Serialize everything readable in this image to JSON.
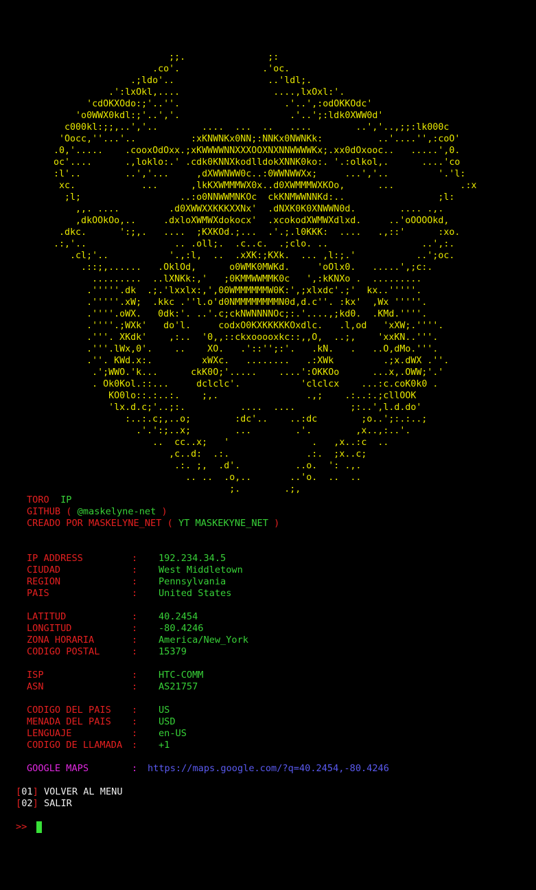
{
  "ascii_art": "                           ;;.               ;:\n                        .co'.               .'oc.\n                    .;ldo'..                 ..'ldl;.\n                .':lxOkl,....                 ....,lxOxl:'.\n            'cdOKXOdo:;'..''.                   .'..',:odOKKOdc'\n          'o0WWX0kdl:;'..','.                    .'..';:ldk0XWW0d'\n        c000kl:;;,..','..        ....  ...  ..   ....        ..','..,;;:lk000c\n       'Oocc,''...'..          :xKNWNKx0NN;:NNKx0NWNKk:          ..'....'',:coO'\n      .0,'.....    .cooxOdOxx.;xKWWWWNNXXXOOXNXNNWWWWKx;.xx0dOxooc..   .....',0.\n      oc'....      .,loklo:.' .cdk0KNNXkodlldokXNNK0ko:. '.:olkol,.      ....'co\n      :l'..        ..','...     ,dXWWNWW0c..:0WWNWWXx;     ...','..         '.'l:\n       xc.            ...      ,lkKXWMMMWX0x..d0XWMMMWXKOo,      ...            .:x\n        ;l;                  ..:o0NNWWMNKOc  ckKNMWWNNKd:..                 ;l:\n          ,,. ....         .d0XWWXXKKKXXNx'  .dNXK0K0XNWWN0d.        .... .,.\n          ,dkOOkOo,..     .dxloXWMWXdokocx'  .xcokodXWMWXdlxd.     ..'oOOOOkd,\n       .dkc.      ':;,.   ....  ;KXKOd.;...  .'.;.l0KKK:  ....   .,::'      :xo.\n      .:,'..                .. .oll;.  .c..c.  .;clo. ..                 ..',:.\n         .cl;'..           '.,:l,  ..  .xXK:;KXk.  ... ,l:;.'           ..';oc.\n           .::;,......   .OklOd,      o0WMK0MWKd.     'oOlx0.   .....',;c:.\n             .........  ..lXNKk:,'   ;0KMMWWMMK0c   ',:kKNXo .  .........\n            .'''''.dk  .;.'lxxlx:,',00WMMMMMMW0K:',;xlxdc'.;'  kx..'''''.\n            .'''''.xW;  .kkc .''l.o'd0NMMMMMMMMN0d,d.c''. :kx'  ,Wx '''''.\n            .''''.oWX.   0dk:'. ..'.c;ckNWNNNNOc;:.'....,;kd0.  .KMd.''''.\n            .''''.;WXk'   do'l.     codxO0KXKKKKKOxdlc.   .l,od   'xXW;.''''.\n            .'''. XKdk'    ,:..  '0,,::ckxooooxkc::,,O,  ..;,    'xxKN..'''.\n            .'''.lWx,0'.    ..    XO.   .'::'';:'.   .kN.   .   ..O,dMo.'''.\n            .''. KWd.x:.         xWXc.   ........   .:XWk         .;x.dWX .''.\n             .';WWO.'k...      ckK0O;'.....    ....':OKKOo      ...x,.OWW;'.'\n             . Ok0Kol.::...     dclclc'.           'clclcx    ...:c.coK0k0 .\n                KO0lo::.:..:.    ;,.                .,;    .:..:.;cllOOK\n                'lx.d.c;'..;:.          ....  ....          ;:..',l.d.do'\n                   :..:.c;,..o;        :dc'..    ..:dc        ;o..';:.:..;\n                     .'.':;..x;        ...        .'.        ,x..,:..'.\n                        ..  cc..x;   '               .   ,x..:c  ..\n                           ,c..d:  .:.              .:.  ;x..c;\n                            .:. ;,  .d'.          ..o.  ': .,.\n                              .. ..  .o,..       ..'o.  ..  ..\n                                      ;.        .;,",
  "header": {
    "line1": {
      "prefix": "TORO",
      "suffix": "IP"
    },
    "line2": {
      "prefix": "GITHUB (",
      "handle": "@maskelyne-net",
      "suffix": ")"
    },
    "line3": {
      "prefix": "CREADO POR MASKELYNE_NET (",
      "middle": "YT MASKEKYNE_NET",
      "suffix": ")"
    }
  },
  "info": {
    "separator": ":",
    "rows": [
      {
        "key": "IP ADDRESS",
        "value": "192.234.34.5"
      },
      {
        "key": "CIUDAD",
        "value": "West Middletown"
      },
      {
        "key": "REGION",
        "value": "Pennsylvania"
      },
      {
        "key": "PAIS",
        "value": "United States"
      },
      {
        "key": "LATITUD",
        "value": "40.2454"
      },
      {
        "key": "LONGITUD",
        "value": "-80.4246"
      },
      {
        "key": "ZONA HORARIA",
        "value": "America/New_York"
      },
      {
        "key": "CODIGO POSTAL",
        "value": "15379"
      },
      {
        "key": "ISP",
        "value": "HTC-COMM"
      },
      {
        "key": "ASN",
        "value": "AS21757"
      },
      {
        "key": "CODIGO DEL PAIS",
        "value": "US"
      },
      {
        "key": "MENADA DEL PAIS",
        "value": "USD"
      },
      {
        "key": "LENGUAJE",
        "value": "en-US"
      },
      {
        "key": "CODIGO DE LLAMADA",
        "value": "+1"
      }
    ],
    "maps": {
      "key": "GOOGLE MAPS",
      "value": "https://maps.google.com/?q=40.2454,-80.4246"
    }
  },
  "menu": [
    {
      "num": "01",
      "label": "VOLVER AL MENU"
    },
    {
      "num": "02",
      "label": "SALIR"
    }
  ],
  "prompt": ">>",
  "colors": {
    "background": "#000000",
    "art": "#e8e800",
    "label": "#e52020",
    "value": "#38d238",
    "maps_key": "#e028e0",
    "maps_link": "#5a5af0",
    "cursor": "#38e038"
  }
}
